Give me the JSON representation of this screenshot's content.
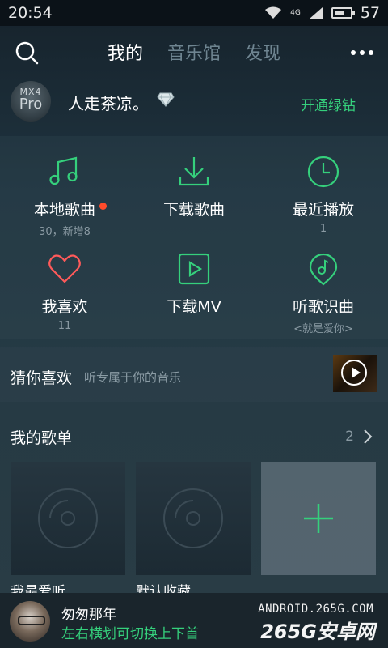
{
  "status_bar": {
    "time": "20:54",
    "battery": "57",
    "network": "4G"
  },
  "nav": {
    "tabs": [
      "我的",
      "音乐馆",
      "发现"
    ],
    "active_tab": 0
  },
  "user": {
    "avatar_line1": "MX4",
    "avatar_line2": "Pro",
    "name": "人走茶凉。",
    "vip_link": "开通绿钻"
  },
  "features": [
    {
      "label": "本地歌曲",
      "sub": "30，新增8",
      "icon": "music-note-icon",
      "badge": true
    },
    {
      "label": "下载歌曲",
      "sub": "",
      "icon": "download-icon",
      "badge": false
    },
    {
      "label": "最近播放",
      "sub": "1",
      "icon": "clock-icon",
      "badge": false
    },
    {
      "label": "我喜欢",
      "sub": "11",
      "icon": "heart-icon",
      "badge": false
    },
    {
      "label": "下载MV",
      "sub": "",
      "icon": "video-play-icon",
      "badge": false
    },
    {
      "label": "听歌识曲",
      "sub": "<就是爱你>",
      "icon": "music-recognize-icon",
      "badge": false
    }
  ],
  "guess": {
    "title": "猜你喜欢",
    "subtitle": "听专属于你的音乐"
  },
  "playlists": {
    "title": "我的歌单",
    "count": "2",
    "items": [
      {
        "label": "我最爱听"
      },
      {
        "label": "默认收藏"
      }
    ]
  },
  "mini_player": {
    "title": "匆匆那年",
    "hint": "左右横划可切换上下首",
    "watermark_top": "ANDROID.265G.COM",
    "watermark_main": "265G安卓网"
  },
  "colors": {
    "accent": "#35d07c",
    "badge": "#ff4b2b"
  }
}
